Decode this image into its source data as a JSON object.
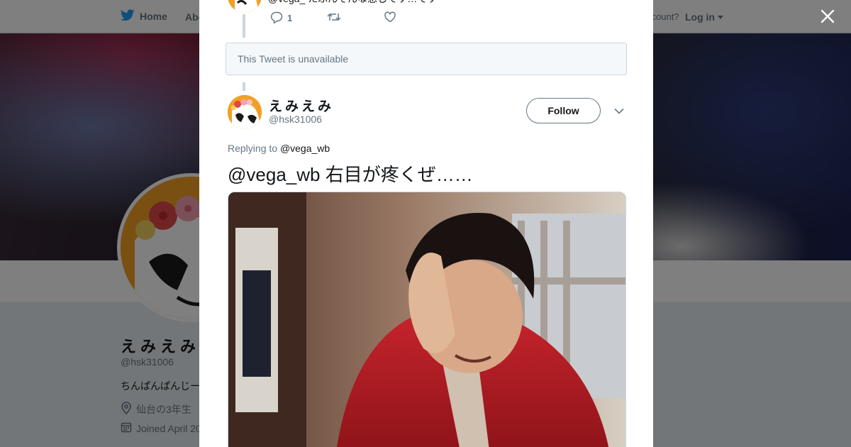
{
  "nav": {
    "home_label": "Home",
    "about_label": "Abo",
    "account_prompt": "ccount?",
    "login_label": "Log in"
  },
  "profile": {
    "name": "えみえみ",
    "handle": "@hsk31006",
    "bio": "ちんぱんぱんじー",
    "location": "仙台の3年生",
    "joined": "Joined April 20"
  },
  "modal": {
    "previous_tweet": {
      "text_partial": "@vega_ たぶんそんな感じです…です",
      "reply_count": "1"
    },
    "unavailable_text": "This Tweet is unavailable",
    "tweet": {
      "author_name": "えみえみ",
      "author_handle": "@hsk31006",
      "follow_label": "Follow",
      "replying_to_prefix": "Replying to",
      "replying_to_handle": "@vega_wb",
      "text": "@vega_wb 右目が疼くぜ……"
    }
  },
  "colors": {
    "twitter_blue": "#1da1f2",
    "text_primary": "#14171a",
    "text_secondary": "#657786",
    "avatar_orange": "#f2a024"
  },
  "icons": {
    "nav_home": "twitter-bird-icon",
    "close": "close-icon",
    "reply": "reply-icon",
    "retweet": "retweet-icon",
    "like": "heart-icon",
    "more": "chevron-down-icon",
    "location": "location-pin-icon",
    "calendar": "calendar-icon"
  }
}
